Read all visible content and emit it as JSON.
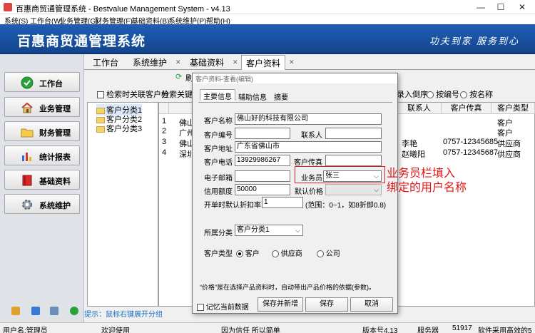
{
  "window": {
    "title": "百惠商贸通管理系统 - Bestvalue Management System - v4.13",
    "controls": {
      "minimize": "—",
      "maximize": "☐",
      "close": "✕"
    }
  },
  "menu": [
    "系统(S)",
    "工作台(W)",
    "业务管理(G)",
    "财务管理(F)",
    "基础资料(B)",
    "系统维护(P)",
    "帮助(H)"
  ],
  "banner": {
    "title": "百惠商贸通管理系统",
    "slogan": "功夫到家 服务到心"
  },
  "nav": [
    {
      "label": "工作台",
      "icon": "check-icon"
    },
    {
      "label": "业务管理",
      "icon": "home-icon"
    },
    {
      "label": "财务管理",
      "icon": "folder-icon"
    },
    {
      "label": "统计报表",
      "icon": "chart-icon"
    },
    {
      "label": "基础资料",
      "icon": "book-icon"
    },
    {
      "label": "系统维护",
      "icon": "gear-icon"
    }
  ],
  "tabs": [
    "工作台",
    "系统维护",
    "基础资料",
    "客户资料"
  ],
  "toolbar": {
    "refresh": "刷"
  },
  "filter": {
    "search_by_category": "检索时关联客户分",
    "keyword_label": "检索关键词",
    "reverse_order": "录入倒序",
    "by_code": "按编号",
    "by_name": "按名称"
  },
  "tree": [
    "客户分类1",
    "客户分类2",
    "客户分类3"
  ],
  "grid": {
    "headers": [
      "联系人",
      "客户传真",
      "客户类型"
    ],
    "row_numbers": [
      "1",
      "2",
      "3",
      "4"
    ],
    "left_cells": [
      "佛山",
      "广州",
      "佛山",
      "深圳"
    ],
    "rows": [
      {
        "contact": "",
        "fax": "",
        "type": "客户"
      },
      {
        "contact": "",
        "fax": "",
        "type": "客户"
      },
      {
        "contact": "李艳",
        "fax": "0757-12345685",
        "type": "供应商"
      },
      {
        "contact": "赵曦阳",
        "fax": "0757-12345687",
        "type": "供应商"
      }
    ]
  },
  "hint": "提示：鼠标右键展开分组",
  "status": {
    "user": "用户名:管理员",
    "welcome": "欢迎使用",
    "motto": "因为信任 所以简单",
    "version": "版本号4.13",
    "server_label": "服务器",
    "server_value": "51917",
    "desc": "软件采用高效的5"
  },
  "dialog": {
    "title": "客户资料-查看(编辑)",
    "tabs": [
      "主要信息",
      "辅助信息",
      "摘要"
    ],
    "fields": {
      "name_label": "客户名称",
      "name": "佛山好的科技有限公司",
      "code_label": "客户编号",
      "code": "",
      "contact_label": "联系人",
      "contact": "",
      "address_label": "客户地址",
      "address": "广东省佛山市",
      "phone_label": "客户电话",
      "phone": "13929986267",
      "fax_label": "客户传真",
      "fax": "",
      "email_label": "电子邮箱",
      "email": "",
      "salesman_label": "业务员",
      "salesman": "张三",
      "credit_label": "信用额度",
      "credit": "50000",
      "price_label": "默认价格",
      "price": "",
      "discount_label": "开单时默认折扣率",
      "discount": "1",
      "discount_hint": "(范围：0~1，如8折即0.8)",
      "category_label": "所属分类",
      "category": "客户分类1",
      "type_label": "客户类型",
      "types": [
        "客户",
        "供应商",
        "公司"
      ],
      "note": "“价格”是在选择产品资料时，自动带出产品价格的依据(参数)。"
    },
    "remember": "记忆当前数据",
    "buttons": {
      "save_new": "保存并新增",
      "save": "保存",
      "cancel": "取消"
    }
  },
  "annotation": {
    "line1": "业务员栏填入",
    "line2": "绑定的用户名称",
    "color": "#e01818"
  },
  "colors": {
    "banner": "#1f5fb6",
    "accent_red": "#e01818",
    "hint": "#1a6fc4"
  }
}
